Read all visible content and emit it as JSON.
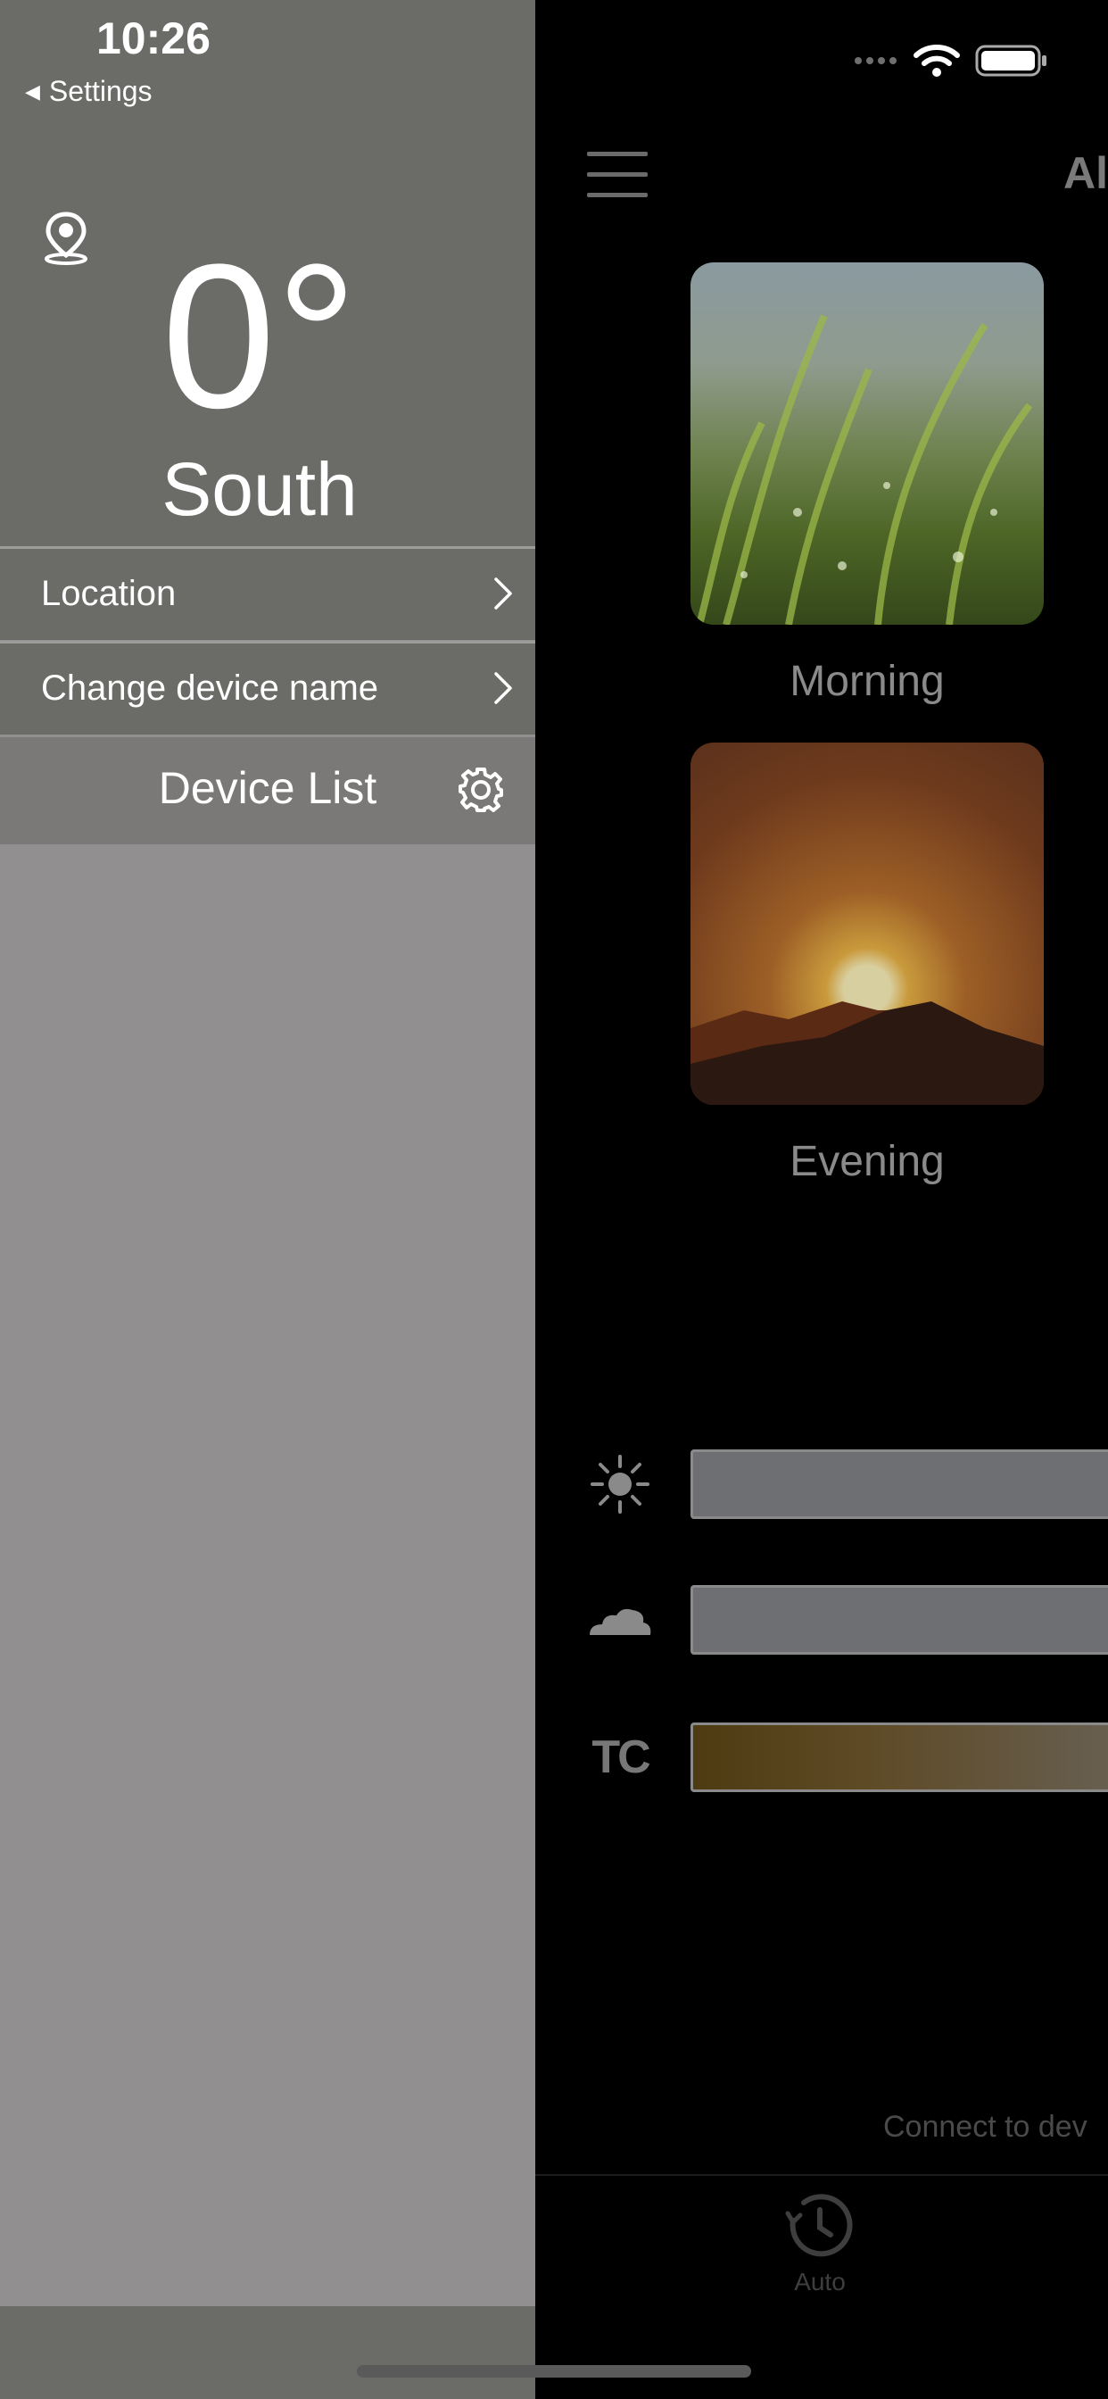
{
  "status_bar": {
    "time": "10:26",
    "back_label": "Settings"
  },
  "drawer": {
    "temperature": "0°",
    "location_name": "South",
    "menu": [
      {
        "label": "Location"
      },
      {
        "label": "Change device name"
      }
    ],
    "device_list_label": "Device List"
  },
  "main": {
    "title": "Al",
    "scenes": [
      {
        "label": "Morning"
      },
      {
        "label": "Evening"
      }
    ],
    "sliders": [
      {
        "icon": "sun-icon"
      },
      {
        "icon": "cloud-icon"
      },
      {
        "icon": "tc-icon",
        "text": "TC"
      }
    ],
    "connect_text": "Connect to dev",
    "tabs": [
      {
        "label": "Auto",
        "icon": "clock-icon"
      }
    ]
  }
}
